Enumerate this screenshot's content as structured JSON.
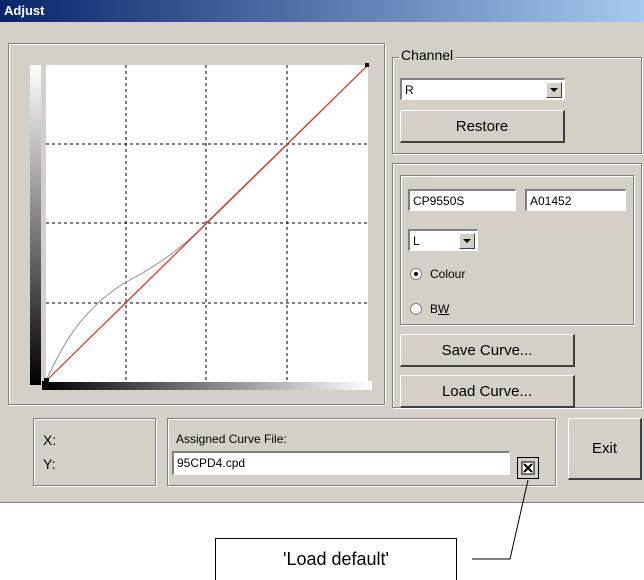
{
  "window": {
    "title": "Adjust"
  },
  "channel": {
    "legend": "Channel",
    "selected": "R",
    "restore_label": "Restore"
  },
  "curve_info": {
    "model": "CP9550S",
    "serial": "A01452",
    "mode_selected": "L",
    "colour_label": "Colour",
    "bw_label": "BW",
    "colour_selected": true
  },
  "buttons": {
    "save_curve": "Save Curve...",
    "load_curve": "Load Curve...",
    "exit": "Exit"
  },
  "coords": {
    "x_label": "X:",
    "y_label": "Y:"
  },
  "assigned": {
    "label": "Assigned Curve File:",
    "file": "95CPD4.cpd"
  },
  "callout": {
    "text": "'Load default'"
  },
  "colors": {
    "identity_line": "#e03020",
    "curve_line": "#a0a0a0"
  }
}
